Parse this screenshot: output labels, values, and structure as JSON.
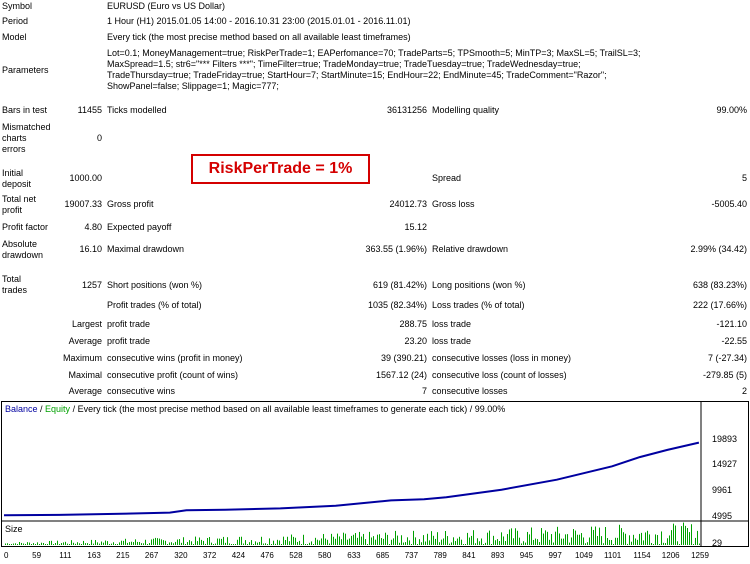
{
  "report": {
    "symbol_label": "Symbol",
    "symbol_value": "EURUSD (Euro vs US Dollar)",
    "period_label": "Period",
    "period_value": "1 Hour (H1) 2015.01.05 14:00 - 2016.10.31 23:00 (2015.01.01 - 2016.11.01)",
    "model_label": "Model",
    "model_value": "Every tick (the most precise method based on all available least timeframes)",
    "parameters_label": "Parameters",
    "parameters_lines": [
      "Lot=0.1; MoneyManagement=true; RiskPerTrade=1; EAPerfomance=70; TradeParts=5; TPSmooth=5; MinTP=3; MaxSL=5; TrailSL=3;",
      "MaxSpread=1.5; str6=\"*** Filters ***\"; TimeFilter=true; TradeMonday=true; TradeTuesday=true; TradeWednesday=true;",
      "TradeThursday=true; TradeFriday=true; StartHour=7; StartMinute=15; EndHour=22; EndMinute=45; TradeComment=\"Razor\";",
      "ShowPanel=false; Slippage=1; Magic=777;"
    ],
    "bars_label": "Bars in test",
    "bars_value": "11455",
    "ticks_label": "Ticks modelled",
    "ticks_value": "36131256",
    "quality_label": "Modelling quality",
    "quality_value": "99.00%",
    "mismatch_label_1": "Mismatched",
    "mismatch_label_2": "charts",
    "mismatch_label_3": "errors",
    "mismatch_value": "0",
    "callout": "RiskPerTrade = 1%",
    "initial_label_1": "Initial",
    "initial_label_2": "deposit",
    "initial_value": "1000.00",
    "spread_label": "Spread",
    "spread_value": "5",
    "netprofit_label_1": "Total net",
    "netprofit_label_2": "profit",
    "netprofit_value": "19007.33",
    "grossprofit_label": "Gross profit",
    "grossprofit_value": "24012.73",
    "grossloss_label": "Gross loss",
    "grossloss_value": "-5005.40",
    "pf_label": "Profit factor",
    "pf_value": "4.80",
    "payoff_label": "Expected payoff",
    "payoff_value": "15.12",
    "absdd_label_1": "Absolute",
    "absdd_label_2": "drawdown",
    "absdd_value": "16.10",
    "maxdd_label": "Maximal drawdown",
    "maxdd_value": "363.55 (1.96%)",
    "reldd_label": "Relative drawdown",
    "reldd_value": "2.99% (34.42)",
    "trades_label_1": "Total",
    "trades_label_2": "trades",
    "trades_value": "1257",
    "short_label": "Short positions (won %)",
    "short_value": "619 (81.42%)",
    "long_label": "Long positions (won %)",
    "long_value": "638 (83.23%)",
    "profittrades_label": "Profit trades (% of total)",
    "profittrades_value": "1035 (82.34%)",
    "losstrades_label": "Loss trades (% of total)",
    "losstrades_value": "222 (17.66%)",
    "largest_label": "Largest",
    "largest_profit_label": "profit trade",
    "largest_profit_value": "288.75",
    "largest_loss_label": "loss trade",
    "largest_loss_value": "-121.10",
    "average_label": "Average",
    "average_profit_label": "profit trade",
    "average_profit_value": "23.20",
    "average_loss_label": "loss trade",
    "average_loss_value": "-22.55",
    "maximum_label": "Maximum",
    "cwins_money_label": "consecutive wins (profit in money)",
    "cwins_money_value": "39 (390.21)",
    "closses_money_label": "consecutive losses (loss in money)",
    "closses_money_value": "7 (-27.34)",
    "maximal_label": "Maximal",
    "cprofit_count_label": "consecutive profit (count of wins)",
    "cprofit_count_value": "1567.12 (24)",
    "closs_count_label": "consecutive loss (count of losses)",
    "closs_count_value": "-279.85 (5)",
    "average2_label": "Average",
    "avg_cwins_label": "consecutive wins",
    "avg_cwins_value": "7",
    "avg_closses_label": "consecutive losses",
    "avg_closses_value": "2"
  },
  "chart_header": {
    "balance": "Balance",
    "sep1": " / ",
    "equity": "Equity",
    "rest": " / Every tick (the most precise method based on all available least timeframes to generate each tick) / 99.00%"
  },
  "size_label": "Size",
  "colors": {
    "balance": "#0000a0",
    "equity": "#00a000",
    "size_bars": "#00a000",
    "callout": "#d40000"
  },
  "chart_data": {
    "type": "line",
    "series": [
      {
        "name": "Balance",
        "x": [
          0,
          100,
          200,
          300,
          330,
          400,
          500,
          600,
          700,
          760,
          800,
          900,
          1000,
          1100,
          1150,
          1200,
          1257
        ],
        "y": [
          1000,
          1100,
          1350,
          1700,
          2300,
          2450,
          2800,
          3500,
          4900,
          5200,
          5700,
          7700,
          10300,
          13800,
          16200,
          18100,
          20007
        ]
      }
    ],
    "y_ticks": [
      "19893",
      "14927",
      "9961",
      "4995",
      "29"
    ],
    "x_ticks": [
      "0",
      "59",
      "111",
      "163",
      "215",
      "267",
      "320",
      "372",
      "424",
      "476",
      "528",
      "580",
      "633",
      "685",
      "737",
      "789",
      "841",
      "893",
      "945",
      "997",
      "1049",
      "1101",
      "1154",
      "1206",
      "1259"
    ],
    "ylim": [
      29,
      19893
    ],
    "xlim": [
      0,
      1259
    ],
    "grid": false
  }
}
